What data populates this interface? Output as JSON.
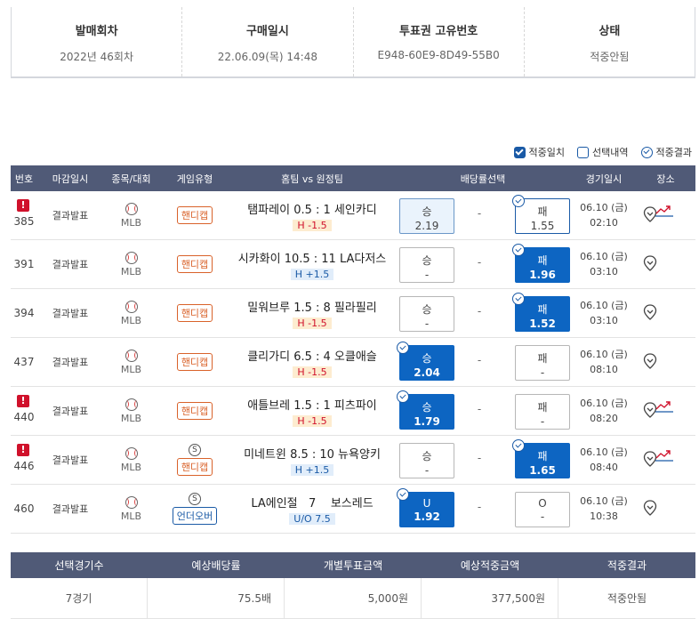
{
  "info": {
    "round_label": "발매회차",
    "round_value": "2022년 46회차",
    "purchase_label": "구매일시",
    "purchase_value": "22.06.09(목) 14:48",
    "ticket_label": "투표권 고유번호",
    "ticket_value": "E948-60E9-8D49-55B0",
    "status_label": "상태",
    "status_value": "적중안됨"
  },
  "legend": {
    "hit_match": "적중일치",
    "selection": "선택내역",
    "hit_result": "적중결과"
  },
  "table": {
    "headers": {
      "no": "번호",
      "close": "마감일시",
      "sport": "종목/대회",
      "type": "게임유형",
      "teams": "홈팀 vs 원정팀",
      "odds": "배당률선택",
      "date": "경기일시",
      "place": "장소"
    },
    "rows": [
      {
        "no": "385",
        "alert": "!",
        "close": "결과발표",
        "league": "MLB",
        "type": "핸디캡",
        "teams": "탬파레이 0.5 : 1 세인카디",
        "hcap": "H -1.5",
        "left_label": "승",
        "left_odds": "2.19",
        "dash": "-",
        "right_label": "패",
        "right_odds": "1.55",
        "date": "06.10 (금)",
        "time": "02:10"
      },
      {
        "no": "391",
        "close": "결과발표",
        "league": "MLB",
        "type": "핸디캡",
        "teams": "시카화이 10.5 : 11 LA다저스",
        "hcap": "H +1.5",
        "left_label": "승",
        "left_odds": "-",
        "dash": "-",
        "right_label": "패",
        "right_odds": "1.96",
        "date": "06.10 (금)",
        "time": "03:10"
      },
      {
        "no": "394",
        "close": "결과발표",
        "league": "MLB",
        "type": "핸디캡",
        "teams": "밀워브루 1.5 : 8 필라필리",
        "hcap": "H -1.5",
        "left_label": "승",
        "left_odds": "-",
        "dash": "-",
        "right_label": "패",
        "right_odds": "1.52",
        "date": "06.10 (금)",
        "time": "03:10"
      },
      {
        "no": "437",
        "close": "결과발표",
        "league": "MLB",
        "type": "핸디캡",
        "teams": "클리가디 6.5 : 4 오클애슬",
        "hcap": "H -1.5",
        "left_label": "승",
        "left_odds": "2.04",
        "dash": "-",
        "right_label": "패",
        "right_odds": "-",
        "date": "06.10 (금)",
        "time": "08:10"
      },
      {
        "no": "440",
        "alert": "!",
        "close": "결과발표",
        "league": "MLB",
        "type": "핸디캡",
        "teams": "애틀브레 1.5 : 1 피츠파이",
        "hcap": "H -1.5",
        "left_label": "승",
        "left_odds": "1.79",
        "dash": "-",
        "right_label": "패",
        "right_odds": "-",
        "date": "06.10 (금)",
        "time": "08:20"
      },
      {
        "no": "446",
        "alert": "!",
        "close": "결과발표",
        "league": "MLB",
        "s": "S",
        "type": "핸디캡",
        "teams": "미네트윈 8.5 : 10 뉴욕양키",
        "hcap": "H +1.5",
        "left_label": "승",
        "left_odds": "-",
        "dash": "-",
        "right_label": "패",
        "right_odds": "1.65",
        "date": "06.10 (금)",
        "time": "08:40"
      },
      {
        "no": "460",
        "close": "결과발표",
        "league": "MLB",
        "s": "S",
        "type": "언더오버",
        "teams": "LA에인절   7    보스레드",
        "hcap": "U/O 7.5",
        "left_label": "U",
        "left_odds": "1.92",
        "dash": "-",
        "right_label": "O",
        "right_odds": "-",
        "date": "06.10 (금)",
        "time": "10:38"
      }
    ]
  },
  "summary": {
    "headers": {
      "games": "선택경기수",
      "odds": "예상배당률",
      "amount": "개별투표금액",
      "payout": "예상적중금액",
      "result": "적중결과"
    },
    "values": {
      "games": "7경기",
      "odds": "75.5배",
      "amount": "5,000원",
      "payout": "377,500원",
      "result": "적중안됨"
    }
  },
  "colors": {
    "header_bg": "#505a77",
    "selected_blue": "#0d65c2",
    "alert_red": "#d0112b",
    "handicap_orange": "#d9622a"
  }
}
